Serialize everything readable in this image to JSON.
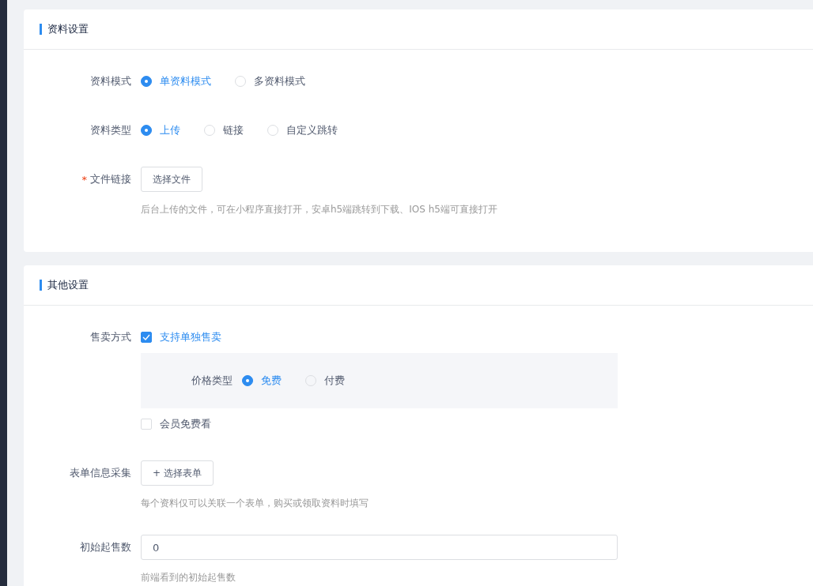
{
  "sections": [
    {
      "title": "资料设置",
      "fields": [
        {
          "label": "资料模式",
          "kind": "radio",
          "options": [
            {
              "label": "单资料模式",
              "selected": true
            },
            {
              "label": "多资料模式",
              "selected": false
            }
          ]
        },
        {
          "label": "资料类型",
          "kind": "radio",
          "options": [
            {
              "label": "上传",
              "selected": true
            },
            {
              "label": "链接",
              "selected": false
            },
            {
              "label": "自定义跳转",
              "selected": false
            }
          ]
        },
        {
          "label": "文件链接",
          "required_mark": "*",
          "kind": "button",
          "button": "选择文件",
          "hint": "后台上传的文件，可在小程序直接打开，安卓h5端跳转到下载、IOS h5端可直接打开"
        }
      ]
    },
    {
      "title": "其他设置",
      "fields": [
        {
          "label": "售卖方式",
          "kind": "checks",
          "items": [
            {
              "label": "支持单独售卖",
              "checked": true,
              "sub": {
                "label": "价格类型",
                "options": [
                  {
                    "label": "免费",
                    "selected": true
                  },
                  {
                    "label": "付费",
                    "selected": false
                  }
                ]
              }
            },
            {
              "label": "会员免费看",
              "checked": false
            }
          ]
        },
        {
          "label": "表单信息采集",
          "kind": "button",
          "button": "+ 选择表单",
          "hint": "每个资料仅可以关联一个表单，购买或领取资料时填写"
        },
        {
          "label": "初始起售数",
          "kind": "input",
          "value": "0",
          "hint": "前端看到的初始起售数"
        }
      ]
    }
  ]
}
